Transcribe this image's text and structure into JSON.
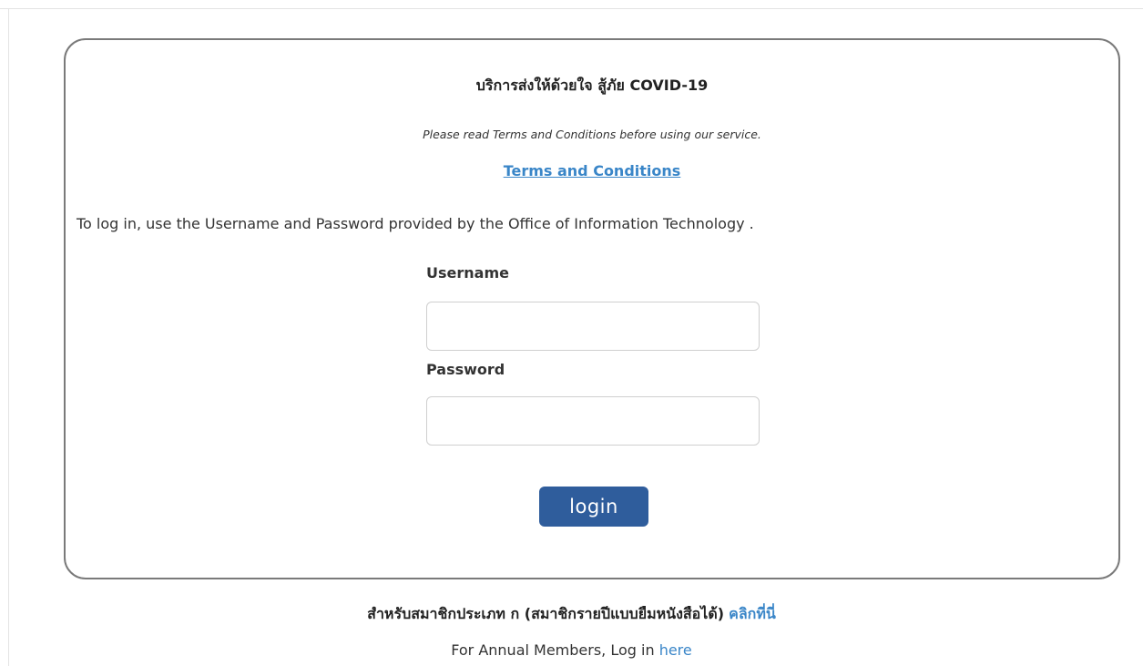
{
  "card": {
    "title": "บริการส่งให้ด้วยใจ สู้ภัย COVID-19",
    "notice": "Please read Terms and Conditions before using our service.",
    "terms_link": "Terms and Conditions",
    "instructions": "To log in, use the Username and Password provided by the Office of Information Technology ."
  },
  "form": {
    "username_label": "Username",
    "username_value": "",
    "password_label": "Password",
    "password_value": "",
    "login_button": "login"
  },
  "footer": {
    "thai_member_text": "สำหรับสมาชิกประเภท ก (สมาชิกรายปีแบบยืมหนังสือได้)",
    "thai_member_link": "คลิกที่นี่",
    "annual_member_text": "For Annual Members, Log in",
    "annual_member_link": "here"
  },
  "colors": {
    "link": "#3a86c8",
    "button": "#2f5d9c",
    "card_border": "#7a7a7a"
  }
}
